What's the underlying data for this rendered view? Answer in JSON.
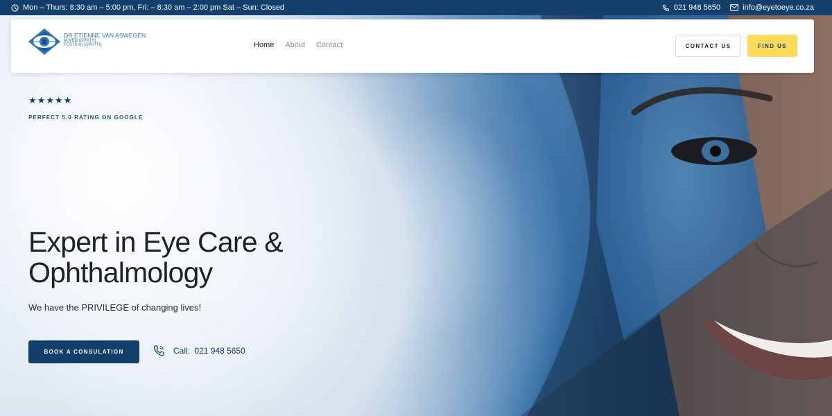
{
  "topbar": {
    "hours": "Mon – Thurs: 8:30 am – 5:00 pm, Fri: – 8:30 am – 2:00 pm Sat – Sun: Closed",
    "phone": "021 948 5650",
    "email": "info@eyetoeye.co.za"
  },
  "logo": {
    "line1": "DR ETIENNE VAN ASWEGEN",
    "line2": "M.MED (OPHTH)",
    "line3": "FCS (S.A) (OPHTH)"
  },
  "nav": {
    "items": [
      {
        "label": "Home",
        "active": true
      },
      {
        "label": "About",
        "active": false
      },
      {
        "label": "Contact",
        "active": false
      }
    ]
  },
  "header": {
    "contact_label": "CONTACT US",
    "find_label": "FIND US"
  },
  "hero": {
    "rating_value": 5,
    "rating_text": "PERFECT 5.0 RATING ON GOOGLE",
    "headline_line1": "Expert in Eye Care &",
    "headline_line2": "Ophthalmology",
    "subline": "We have the PRIVILEGE of changing lives!",
    "book_label": "BOOK A CONSULATION",
    "call_prefix": "Call:",
    "call_number": "021 948 5650"
  },
  "colors": {
    "brand_navy": "#123f6b",
    "accent_yellow": "#fddb5a",
    "logo_blue": "#2c74b5"
  }
}
